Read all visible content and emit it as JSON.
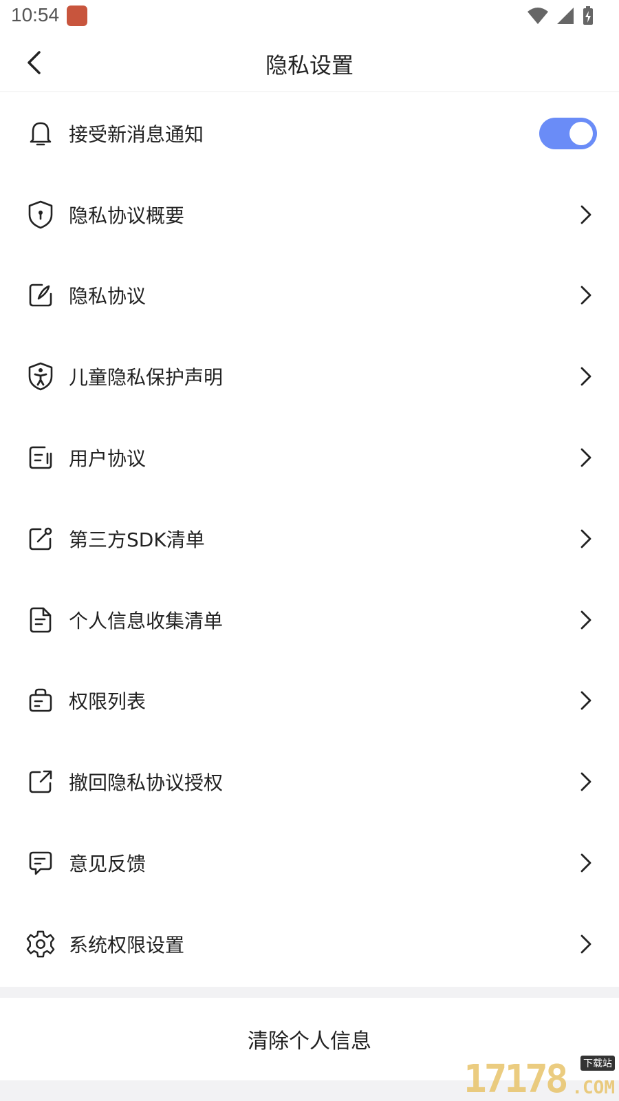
{
  "status": {
    "time": "10:54"
  },
  "nav": {
    "title": "隐私设置"
  },
  "items": [
    {
      "label": "接受新消息通知",
      "icon": "bell-icon",
      "toggle_on": true
    },
    {
      "label": "隐私协议概要",
      "icon": "shield-lock-icon"
    },
    {
      "label": "隐私协议",
      "icon": "edit-note-icon"
    },
    {
      "label": "儿童隐私保护声明",
      "icon": "child-shield-icon"
    },
    {
      "label": "用户协议",
      "icon": "document-icon"
    },
    {
      "label": "第三方SDK清单",
      "icon": "edit-box-icon"
    },
    {
      "label": "个人信息收集清单",
      "icon": "file-list-icon"
    },
    {
      "label": "权限列表",
      "icon": "bag-list-icon"
    },
    {
      "label": "撤回隐私协议授权",
      "icon": "share-out-icon"
    },
    {
      "label": "意见反馈",
      "icon": "message-icon"
    },
    {
      "label": "系统权限设置",
      "icon": "gear-icon"
    }
  ],
  "clear_button": {
    "label": "清除个人信息"
  },
  "watermark": {
    "number": "17178",
    "tag": "下载站",
    "suffix": ".COM"
  },
  "colors": {
    "toggle": "#6a8cf7",
    "app_icon": "#c8553d"
  }
}
